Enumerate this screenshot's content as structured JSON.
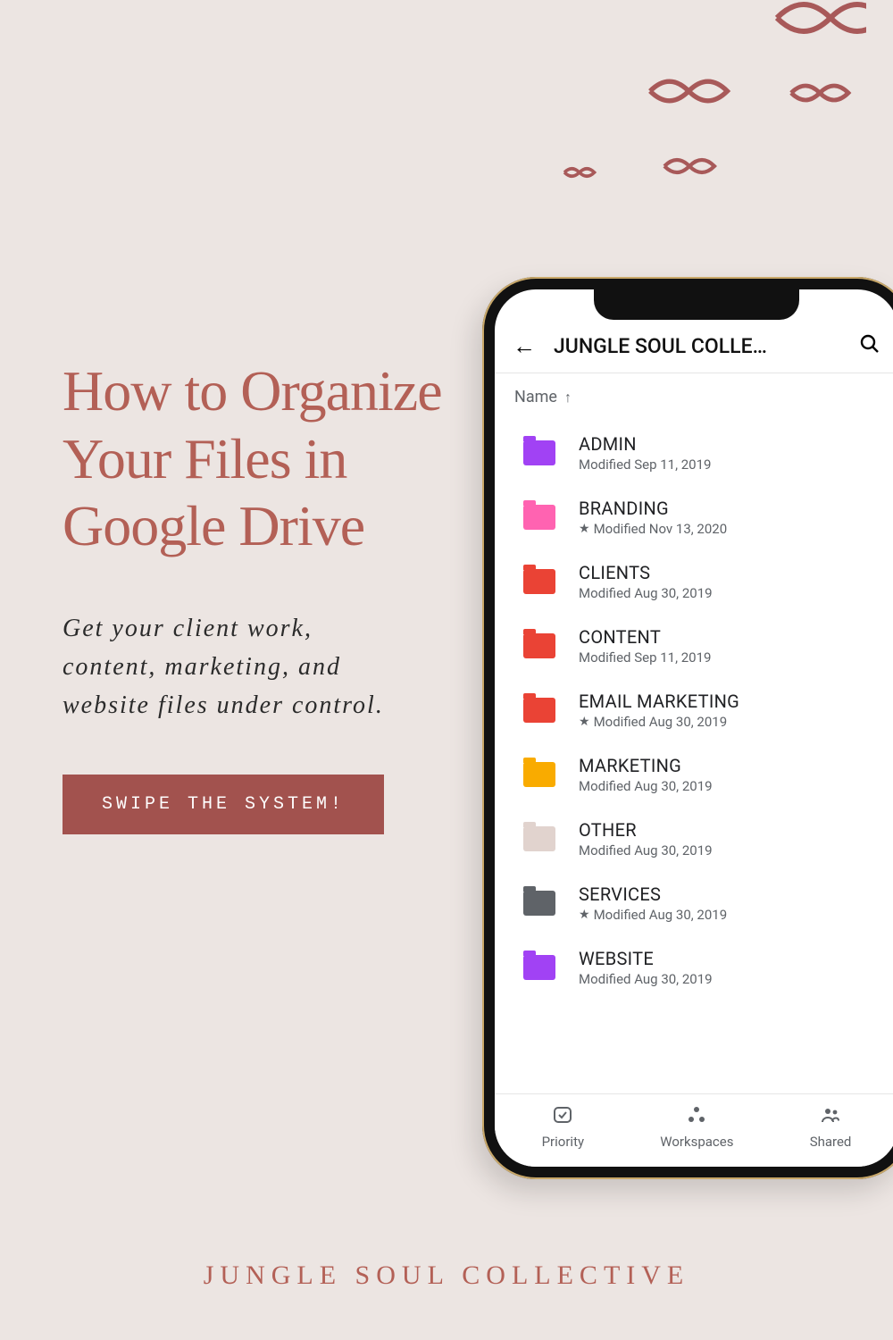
{
  "decor": {
    "sparkle_count": 5
  },
  "headline": "How to Organize Your Files in Google Drive",
  "subhead": "Get your client work, content, marketing, and website files under control.",
  "cta_label": "swipe the system!",
  "brand": "JUNGLE SOUL COLLECTIVE",
  "colors": {
    "bg": "#ece5e2",
    "accent": "#b36056",
    "cta_bg": "#a2524e"
  },
  "phone": {
    "header": {
      "title": "JUNGLE SOUL COLLE…"
    },
    "sort": {
      "label": "Name",
      "direction": "↑"
    },
    "folders": [
      {
        "name": "ADMIN",
        "modified": "Modified Sep 11, 2019",
        "starred": false,
        "color": "#a142f4"
      },
      {
        "name": "BRANDING",
        "modified": "Modified Nov 13, 2020",
        "starred": true,
        "color": "#ff63b1"
      },
      {
        "name": "CLIENTS",
        "modified": "Modified Aug 30, 2019",
        "starred": false,
        "color": "#ea4335"
      },
      {
        "name": "CONTENT",
        "modified": "Modified Sep 11, 2019",
        "starred": false,
        "color": "#ea4335"
      },
      {
        "name": "EMAIL MARKETING",
        "modified": "Modified Aug 30, 2019",
        "starred": true,
        "color": "#ea4335"
      },
      {
        "name": "MARKETING",
        "modified": "Modified Aug 30, 2019",
        "starred": false,
        "color": "#f9ab00"
      },
      {
        "name": "OTHER",
        "modified": "Modified Aug 30, 2019",
        "starred": false,
        "color": "#e1d3ce"
      },
      {
        "name": "SERVICES",
        "modified": "Modified Aug 30, 2019",
        "starred": true,
        "color": "#5f6368"
      },
      {
        "name": "WEBSITE",
        "modified": "Modified Aug 30, 2019",
        "starred": false,
        "color": "#a142f4"
      }
    ],
    "nav": [
      {
        "label": "Priority",
        "icon": "check"
      },
      {
        "label": "Workspaces",
        "icon": "workspaces"
      },
      {
        "label": "Shared",
        "icon": "shared"
      }
    ]
  }
}
